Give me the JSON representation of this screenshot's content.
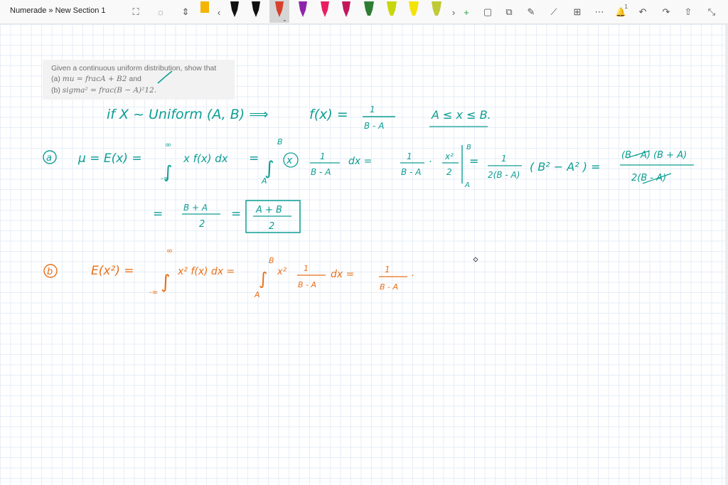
{
  "app": {
    "breadcrumb": "Numerade » New Section 1"
  },
  "toolbar": {
    "tools": [
      {
        "name": "lasso-select-icon",
        "glyph": "⛶"
      },
      {
        "name": "add-space-icon",
        "glyph": "◌"
      },
      {
        "name": "insert-space-icon",
        "glyph": "⇕"
      }
    ],
    "pens": [
      {
        "color": "#f4b400",
        "shape": "marker"
      },
      {
        "color": "#111111",
        "shape": "pen"
      },
      {
        "color": "#111111",
        "shape": "pen"
      },
      {
        "color": "#d9402b",
        "shape": "pen",
        "selected": true
      },
      {
        "color": "#8e24aa",
        "shape": "pen"
      },
      {
        "color": "#e91e63",
        "shape": "pen"
      },
      {
        "color": "#c2185b",
        "shape": "pen"
      },
      {
        "color": "#2e7d32",
        "shape": "highlighter"
      },
      {
        "color": "#c6d70a",
        "shape": "highlighter"
      },
      {
        "color": "#f4e30a",
        "shape": "highlighter"
      },
      {
        "color": "#c0ca33",
        "shape": "highlighter"
      }
    ],
    "right_tools": [
      {
        "name": "scroll-right-icon",
        "glyph": "›"
      },
      {
        "name": "add-pen-icon",
        "glyph": "+"
      },
      {
        "name": "shapes-icon",
        "glyph": "▢"
      },
      {
        "name": "ink-to-shape-icon",
        "glyph": "⧉"
      },
      {
        "name": "ink-to-math-icon",
        "glyph": "✎"
      },
      {
        "name": "ruler-icon",
        "glyph": "⟋"
      },
      {
        "name": "math-icon",
        "glyph": "⊞"
      },
      {
        "name": "more-icon",
        "glyph": "⋯"
      },
      {
        "name": "notification-icon",
        "glyph": "🔔"
      },
      {
        "name": "undo-icon",
        "glyph": "↶"
      },
      {
        "name": "redo-icon",
        "glyph": "↷"
      },
      {
        "name": "share-icon",
        "glyph": "⇧"
      },
      {
        "name": "fullscreen-icon",
        "glyph": "⤡"
      }
    ],
    "scroll_left_glyph": "‹",
    "notification_count": "1"
  },
  "question": {
    "line1": "Given a continuous uniform distribution, show that",
    "line2_prefix": "(a) ",
    "line2_math": "mu = fracA + B2",
    "line2_suffix": " and",
    "line3_prefix": "(b) ",
    "line3_math": "sigma² = frac(B − A)²12."
  },
  "notes": {
    "colors": {
      "teal": "#0d9e94",
      "orange": "#e8701a"
    },
    "line_if": "if  X ~ Uniform (A, B)  ⟹",
    "fx": "f(x) =",
    "fx_num": "1",
    "fx_den": "B - A",
    "range": "A ≤ x ≤ B.",
    "a_label": "a",
    "a_mu": "μ = E(x) =",
    "a_int_upper": "∞",
    "a_int_lower": "-∞",
    "a_integrand": "x f(x) dx",
    "a_eq1": "=",
    "a_int2_upper": "B",
    "a_int2_lower": "A",
    "a_x": "x",
    "a_frac1_num": "1",
    "a_frac1_den": "B - A",
    "a_dx": "dx  =",
    "a_frac2_num": "1",
    "a_frac2_den": "B - A",
    "a_dot": "·",
    "a_x2_num": "x²",
    "a_x2_den": "2",
    "a_eval_upper": "B",
    "a_eval_lower": "A",
    "a_eq2": "=",
    "a_frac3_num": "1",
    "a_frac3_den": "2(B - A)",
    "a_paren": "( B² − A² ) =",
    "a_final_num": "(B - A) (B + A)",
    "a_final_den": "2(B - A)",
    "a2_eq": "=",
    "a2_num": "B + A",
    "a2_den": "2",
    "a2_eq2": "=",
    "a2_box_num": "A + B",
    "a2_box_den": "2",
    "b_label": "b",
    "b_e": "E(x²) =",
    "b_int_upper": "∞",
    "b_int_lower": "-∞",
    "b_integrand": "x² f(x) dx =",
    "b_int2_upper": "B",
    "b_int2_lower": "A",
    "b_x2": "x²",
    "b_frac_num": "1",
    "b_frac_den": "B - A",
    "b_dx": "dx  =",
    "b_res_num": "1",
    "b_res_den": "B - A",
    "b_dot": "·"
  }
}
